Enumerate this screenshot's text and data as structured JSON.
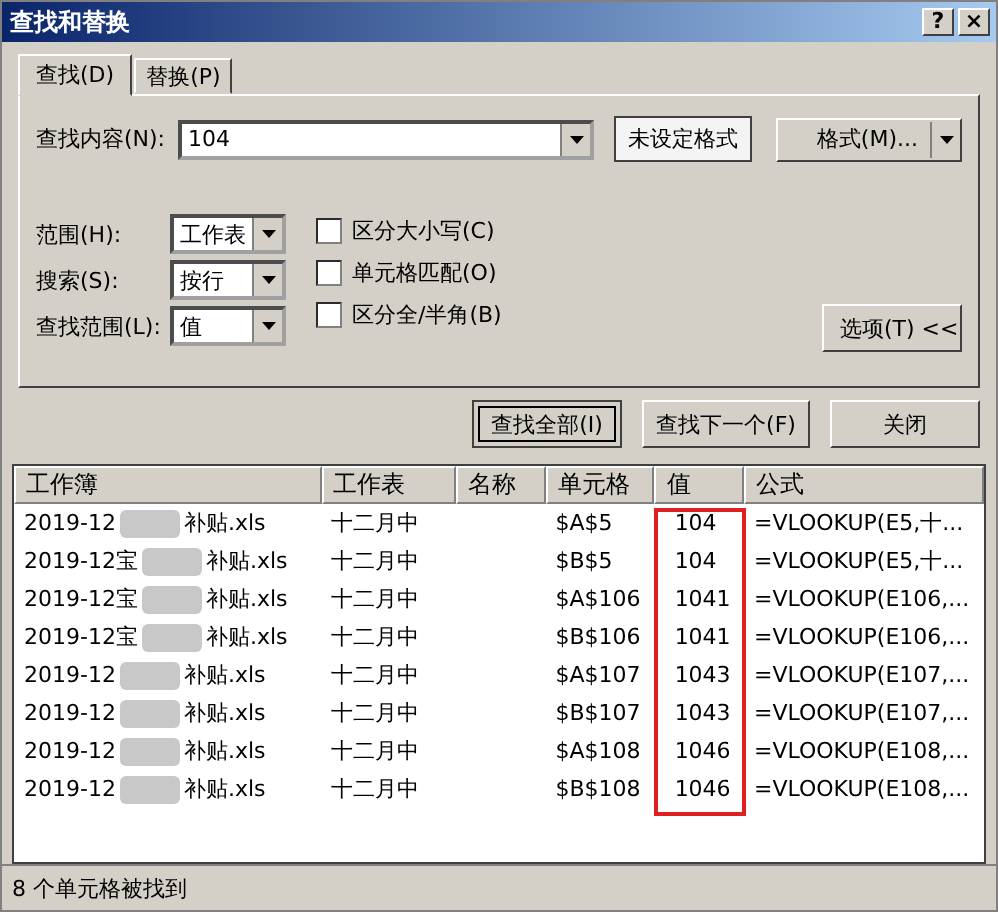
{
  "window": {
    "title": "查找和替换",
    "help": "?",
    "close": "×"
  },
  "tabs": [
    {
      "label": "查找(D)",
      "selected": true
    },
    {
      "label": "替换(P)",
      "selected": false
    }
  ],
  "find": {
    "label": "查找内容(N):",
    "value": "104",
    "format_preview": "未设定格式",
    "format_button": "格式(M)..."
  },
  "options": [
    {
      "label": "范围(H):",
      "value": "工作表"
    },
    {
      "label": "搜索(S):",
      "value": "按行"
    },
    {
      "label": "查找范围(L):",
      "value": "值"
    }
  ],
  "checkboxes": [
    {
      "label": "区分大小写(C)",
      "checked": false
    },
    {
      "label": "单元格匹配(O)",
      "checked": false
    },
    {
      "label": "区分全/半角(B)",
      "checked": false
    }
  ],
  "options_button": "选项(T) <<",
  "buttons": [
    {
      "label": "查找全部(I)",
      "selected": true
    },
    {
      "label": "查找下一个(F)",
      "selected": false
    },
    {
      "label": "关闭",
      "selected": false
    }
  ],
  "table": {
    "columns": [
      "工作簿",
      "工作表",
      "名称",
      "单元格",
      "值",
      "公式"
    ],
    "value_column_highlighted": true,
    "rows": [
      {
        "workbook_start": "2019-12",
        "workbook_end": "补贴.xls",
        "sheet": "十二月中",
        "cell": "$A$5",
        "value": "104",
        "formula": "=VLOOKUP(E5,十..."
      },
      {
        "workbook_start": "2019-12宝",
        "workbook_end": "补贴.xls",
        "sheet": "十二月中",
        "cell": "$B$5",
        "value": "104",
        "formula": "=VLOOKUP(E5,十..."
      },
      {
        "workbook_start": "2019-12宝",
        "workbook_end": "补贴.xls",
        "sheet": "十二月中",
        "cell": "$A$106",
        "value": "1041",
        "formula": "=VLOOKUP(E106,..."
      },
      {
        "workbook_start": "2019-12宝",
        "workbook_end": "补贴.xls",
        "sheet": "十二月中",
        "cell": "$B$106",
        "value": "1041",
        "formula": "=VLOOKUP(E106,..."
      },
      {
        "workbook_start": "2019-12",
        "workbook_end": "补贴.xls",
        "sheet": "十二月中",
        "cell": "$A$107",
        "value": "1043",
        "formula": "=VLOOKUP(E107,..."
      },
      {
        "workbook_start": "2019-12",
        "workbook_end": "补贴.xls",
        "sheet": "十二月中",
        "cell": "$B$107",
        "value": "1043",
        "formula": "=VLOOKUP(E107,..."
      },
      {
        "workbook_start": "2019-12",
        "workbook_end": "补贴.xls",
        "sheet": "十二月中",
        "cell": "$A$108",
        "value": "1046",
        "formula": "=VLOOKUP(E108,..."
      },
      {
        "workbook_start": "2019-12",
        "workbook_end": "补贴.xls",
        "sheet": "十二月中",
        "cell": "$B$108",
        "value": "1046",
        "formula": "=VLOOKUP(E108,..."
      }
    ]
  },
  "status_bar": "8 个单元格被找到"
}
